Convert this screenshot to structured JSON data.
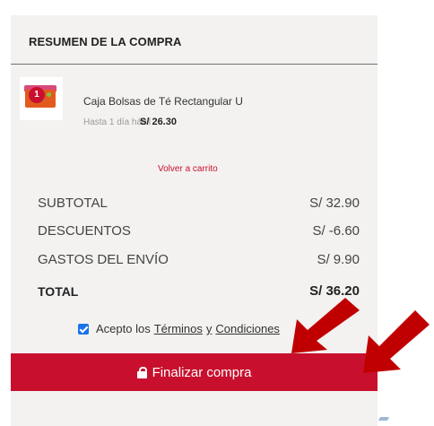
{
  "summary": {
    "title": "RESUMEN DE LA COMPRA"
  },
  "item": {
    "quantity": "1",
    "name": "Caja Bolsas de Té Rectangular U",
    "delivery": "Hasta 1 día hábil",
    "price": "S/ 26.30"
  },
  "back_link": "Volver a carrito",
  "totals": {
    "subtotal_label": "SUBTOTAL",
    "subtotal_value": "S/ 32.90",
    "discount_label": "DESCUENTOS",
    "discount_value": "S/ -6.60",
    "shipping_label": "GASTOS DEL ENVÍO",
    "shipping_value": "S/ 9.90",
    "total_label": "TOTAL",
    "total_value": "S/ 36.20"
  },
  "terms": {
    "prefix": "Acepto los",
    "link1": "Términos",
    "connector": "y",
    "link2": "Condiciones",
    "checked": true
  },
  "cta": {
    "label": "Finalizar compra",
    "icon": "lock-icon"
  },
  "colors": {
    "accent": "#c8102e",
    "panel_bg": "#f3f2f1",
    "checkbox": "#1a73e8",
    "arrow": "#c00000"
  }
}
